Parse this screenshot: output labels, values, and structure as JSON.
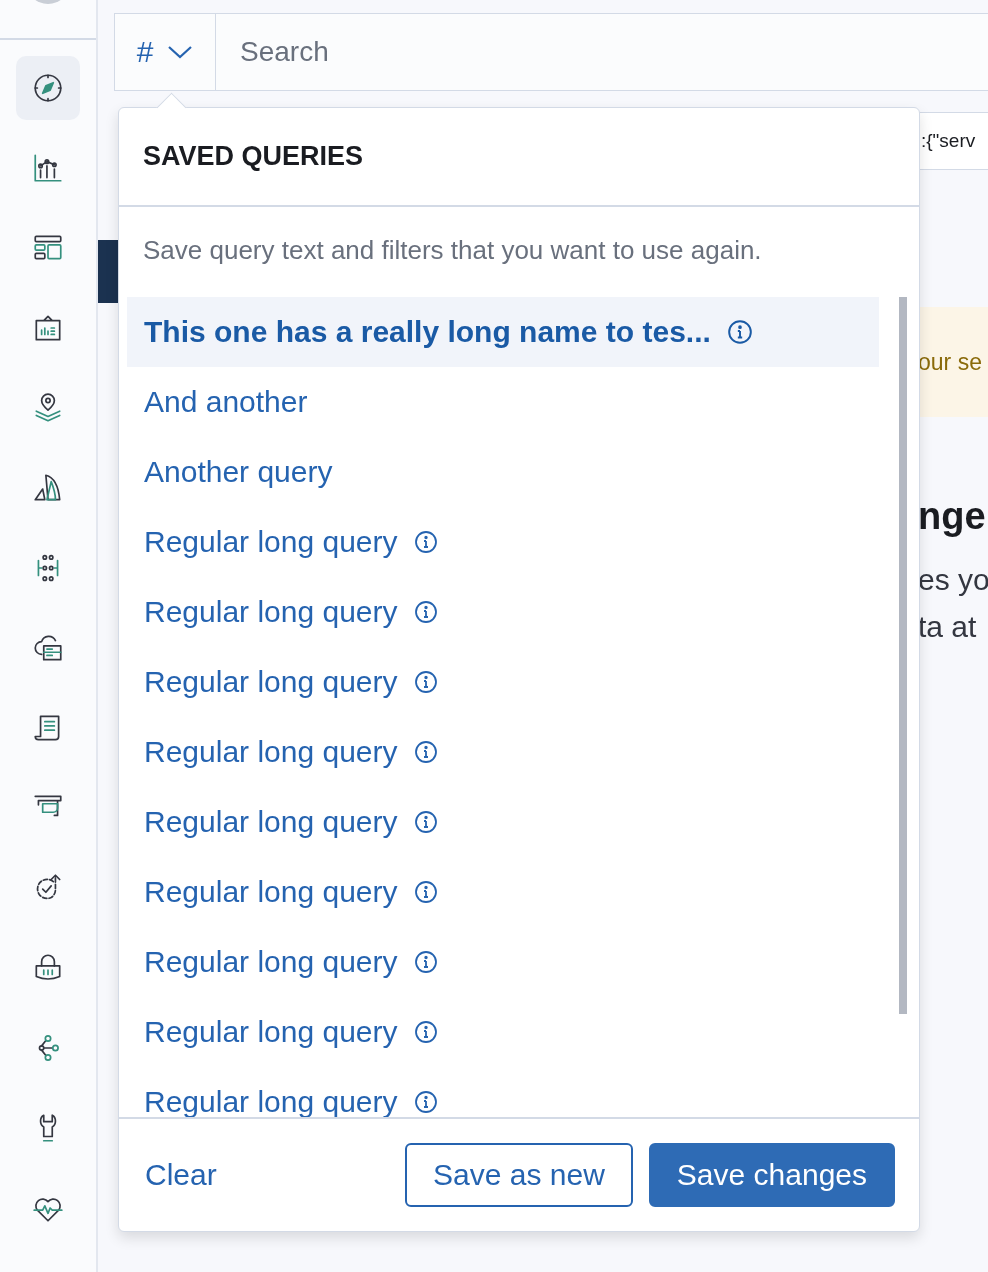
{
  "sidebar": {
    "items": [
      {
        "selected": true
      },
      {
        "selected": false
      },
      {
        "selected": false
      },
      {
        "selected": false
      },
      {
        "selected": false
      },
      {
        "selected": false
      },
      {
        "selected": false
      },
      {
        "selected": false
      },
      {
        "selected": false
      },
      {
        "selected": false
      },
      {
        "selected": false
      },
      {
        "selected": false
      },
      {
        "selected": false
      },
      {
        "selected": false
      },
      {
        "selected": false
      }
    ]
  },
  "search_bar": {
    "query_button": "#",
    "placeholder": "Search"
  },
  "background": {
    "query_snippet": ":{\"serv",
    "callout": "our se",
    "heading": "nge",
    "text_lines": [
      "es yo",
      "ta at"
    ]
  },
  "saved_queries": {
    "title": "SAVED QUERIES",
    "description": "Save query text and filters that you want to use again.",
    "items": [
      {
        "label": "This one has a really long name to tes...",
        "selected": true,
        "info": true
      },
      {
        "label": "And another",
        "selected": false,
        "info": false
      },
      {
        "label": "Another query",
        "selected": false,
        "info": false
      },
      {
        "label": "Regular long query",
        "selected": false,
        "info": true
      },
      {
        "label": "Regular long query",
        "selected": false,
        "info": true
      },
      {
        "label": "Regular long query",
        "selected": false,
        "info": true
      },
      {
        "label": "Regular long query",
        "selected": false,
        "info": true
      },
      {
        "label": "Regular long query",
        "selected": false,
        "info": true
      },
      {
        "label": "Regular long query",
        "selected": false,
        "info": true
      },
      {
        "label": "Regular long query",
        "selected": false,
        "info": true
      },
      {
        "label": "Regular long query",
        "selected": false,
        "info": true
      },
      {
        "label": "Regular long query",
        "selected": false,
        "info": true
      }
    ],
    "clear": "Clear",
    "save_as_new": "Save as new",
    "save_changes": "Save changes"
  }
}
